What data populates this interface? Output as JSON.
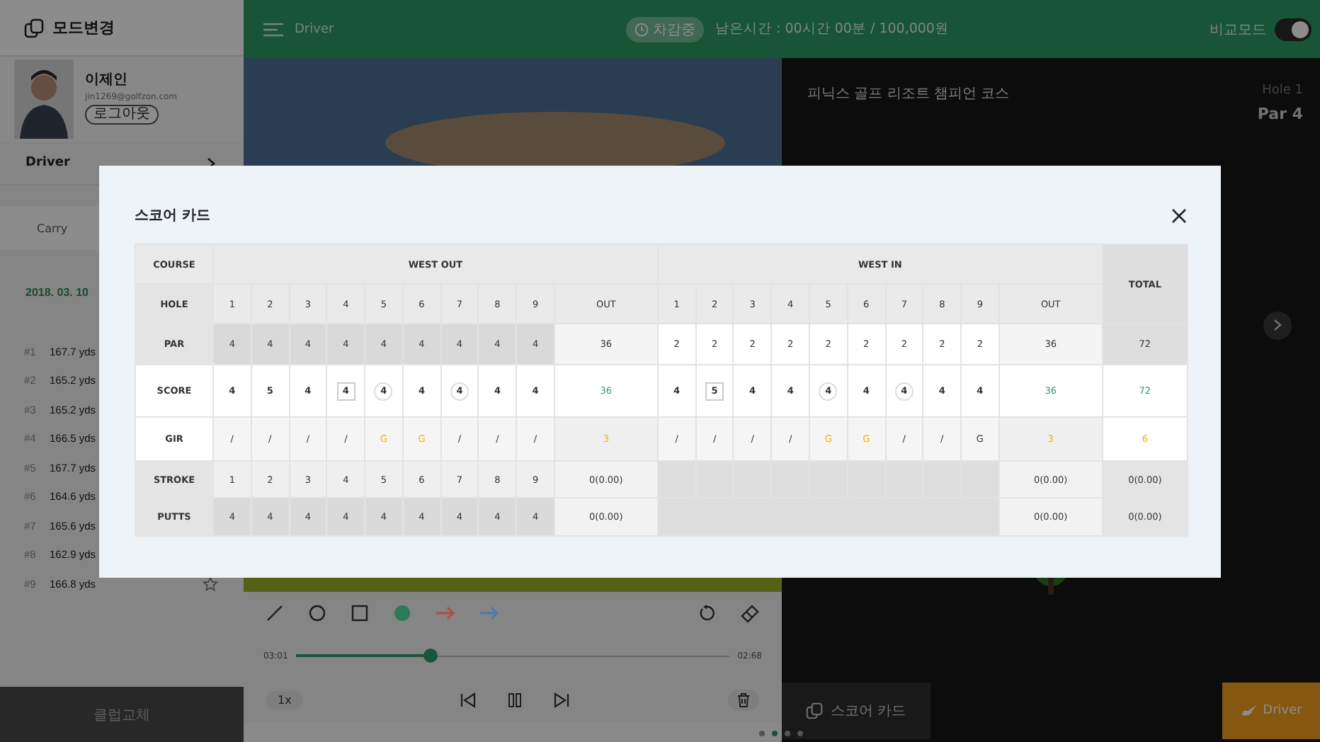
{
  "sidebar": {
    "title": "모드변경",
    "profile": {
      "name": "이제인",
      "email": "jin1269@golfzon.com",
      "logout": "로그아웃"
    },
    "club": "Driver",
    "metric": "Carry",
    "date": "2018. 03. 10",
    "shots": [
      {
        "index": "#1",
        "distance": "167.7 yds"
      },
      {
        "index": "#2",
        "distance": "165.2 yds"
      },
      {
        "index": "#3",
        "distance": "165.2 yds"
      },
      {
        "index": "#4",
        "distance": "166.5 yds"
      },
      {
        "index": "#5",
        "distance": "167.7 yds"
      },
      {
        "index": "#6",
        "distance": "164.6 yds"
      },
      {
        "index": "#7",
        "distance": "165.6 yds"
      },
      {
        "index": "#8",
        "distance": "162.9 yds"
      },
      {
        "index": "#9",
        "distance": "166.8 yds",
        "starred": false
      }
    ],
    "change_club": "클럽교체"
  },
  "topbar": {
    "title": "Driver",
    "status": "차감중",
    "remaining": "남은시간 : 00시간 00분 / 100,000원",
    "compare": {
      "label": "비교모드",
      "on": true
    }
  },
  "player": {
    "tools": [
      {
        "kind": "line"
      },
      {
        "kind": "circle"
      },
      {
        "kind": "square"
      },
      {
        "kind": "dot",
        "color": "#2c7a58"
      },
      {
        "kind": "arrow",
        "color": "#b04a4a"
      },
      {
        "kind": "arrow",
        "color": "#4a7ab0"
      }
    ],
    "elapsed": "03:01",
    "duration": "02:68",
    "level": 0.31,
    "speed": "1x"
  },
  "course": {
    "name": "피닉스 골프 리조트 챔피언 코스",
    "hole": "Hole 1",
    "par": "Par 4"
  },
  "score_button": "스코어 카드",
  "club_button": "Driver",
  "pages": [
    {
      "selected": false
    },
    {
      "selected": true
    },
    {
      "selected": false
    },
    {
      "selected": false
    }
  ],
  "scorecard": {
    "title": "스코어 카드",
    "row_labels": [
      "COURSE",
      "HOLE",
      "PAR",
      "SCORE",
      "GIR",
      "STROKE",
      "PUTTS"
    ],
    "sections": [
      {
        "name": "WEST OUT",
        "holes": [
          "1",
          "2",
          "3",
          "4",
          "5",
          "6",
          "7",
          "8",
          "9"
        ],
        "out_label": "OUT",
        "par": [
          "4",
          "4",
          "4",
          "4",
          "4",
          "4",
          "4",
          "4",
          "4"
        ],
        "par_out": "36",
        "score": [
          {
            "value": "4",
            "kind": "plain"
          },
          {
            "value": "5",
            "kind": "plain"
          },
          {
            "value": "4",
            "kind": "plain"
          },
          {
            "value": "4",
            "kind": "box"
          },
          {
            "value": "4",
            "kind": "circle"
          },
          {
            "value": "4",
            "kind": "plain"
          },
          {
            "value": "4",
            "kind": "circle"
          },
          {
            "value": "4",
            "kind": "plain"
          },
          {
            "value": "4",
            "kind": "plain"
          }
        ],
        "score_out": "36",
        "gir": [
          {
            "value": "/",
            "highlight": false
          },
          {
            "value": "/",
            "highlight": false
          },
          {
            "value": "/",
            "highlight": false
          },
          {
            "value": "/",
            "highlight": false
          },
          {
            "value": "G",
            "highlight": true
          },
          {
            "value": "G",
            "highlight": true
          },
          {
            "value": "/",
            "highlight": false
          },
          {
            "value": "/",
            "highlight": false
          },
          {
            "value": "/",
            "highlight": false
          }
        ],
        "gir_out": {
          "value": "3",
          "highlight": true
        },
        "stroke": [
          "1",
          "2",
          "3",
          "4",
          "5",
          "6",
          "7",
          "8",
          "9"
        ],
        "stroke_out": "0(0.00)",
        "putts": [
          "4",
          "4",
          "4",
          "4",
          "4",
          "4",
          "4",
          "4",
          "4"
        ],
        "putts_out": "0(0.00)"
      },
      {
        "name": "WEST IN",
        "holes": [
          "1",
          "2",
          "3",
          "4",
          "5",
          "6",
          "7",
          "8",
          "9"
        ],
        "out_label": "OUT",
        "par": [
          "2",
          "2",
          "2",
          "2",
          "2",
          "2",
          "2",
          "2",
          "2"
        ],
        "par_out": "36",
        "score": [
          {
            "value": "4",
            "kind": "plain"
          },
          {
            "value": "5",
            "kind": "box"
          },
          {
            "value": "4",
            "kind": "plain"
          },
          {
            "value": "4",
            "kind": "plain"
          },
          {
            "value": "4",
            "kind": "circle"
          },
          {
            "value": "4",
            "kind": "plain"
          },
          {
            "value": "4",
            "kind": "circle"
          },
          {
            "value": "4",
            "kind": "plain"
          },
          {
            "value": "4",
            "kind": "plain"
          }
        ],
        "score_out": "36",
        "gir": [
          {
            "value": "/",
            "highlight": false
          },
          {
            "value": "/",
            "highlight": false
          },
          {
            "value": "/",
            "highlight": false
          },
          {
            "value": "/",
            "highlight": false
          },
          {
            "value": "G",
            "highlight": true
          },
          {
            "value": "G",
            "highlight": true
          },
          {
            "value": "/",
            "highlight": false
          },
          {
            "value": "/",
            "highlight": false
          },
          {
            "value": "G",
            "highlight": false
          }
        ],
        "gir_out": {
          "value": "3",
          "highlight": true
        },
        "stroke_out": "0(0.00)",
        "putts_out": "0(0.00)"
      }
    ],
    "total": {
      "label": "TOTAL",
      "par": "72",
      "score": "72",
      "gir": {
        "value": "6",
        "highlight": true
      },
      "stroke": "0(0.00)",
      "putts": "0(0.00)"
    }
  }
}
